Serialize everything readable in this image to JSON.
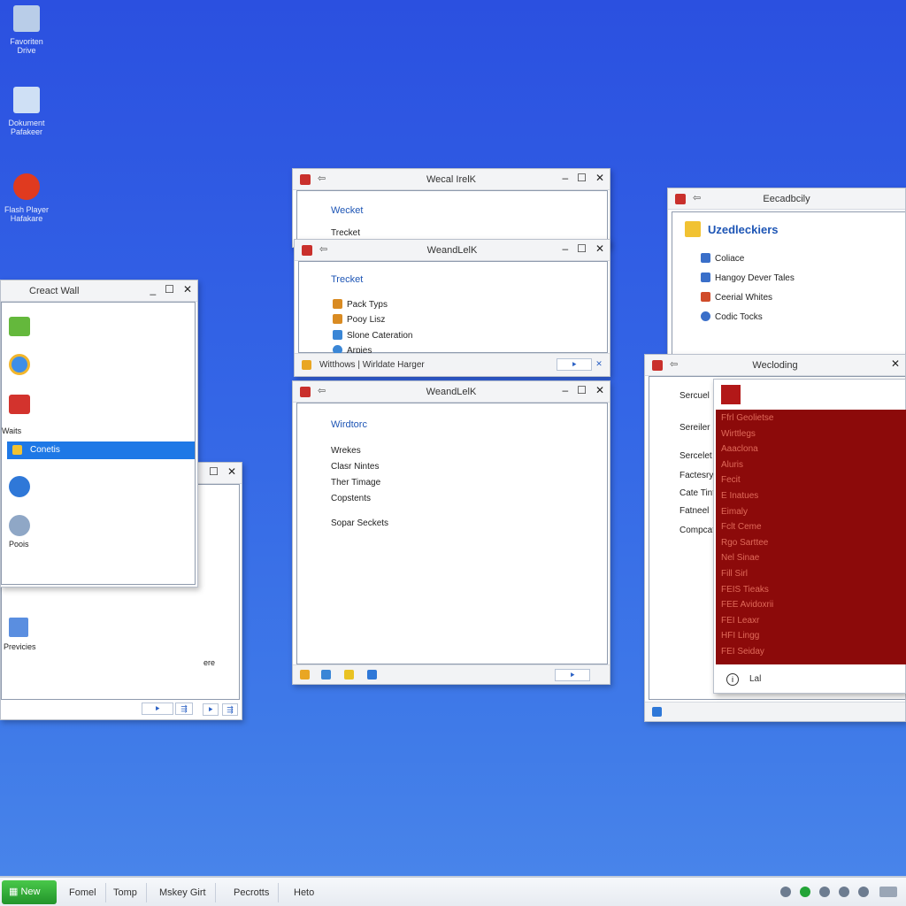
{
  "desktop_icons": [
    {
      "label": "Favoriten Drive",
      "color": "#b9cde8"
    },
    {
      "label": "Dokument Pafakeer",
      "color": "#cfe0f5"
    },
    {
      "label": "Flash Player Hafakare",
      "color": "#e03a1f"
    }
  ],
  "win_left_back": {
    "items": [
      {
        "label": "Previcies",
        "color": "#5a8ee0"
      }
    ],
    "partial_text": "ere",
    "btn1": "⯈",
    "btn2": "⇶"
  },
  "win_left": {
    "title": "Creact Wall",
    "items": [
      {
        "label": "",
        "color": "#64b83c"
      },
      {
        "label": "",
        "color": "#3f8ee6"
      },
      {
        "label": "",
        "color": "#d3332d"
      },
      {
        "label": "Conetis",
        "color": "#f1c232",
        "selected": true
      },
      {
        "label": "",
        "color": "#2f78d8"
      },
      {
        "label": "Poois",
        "color": "#8fa7c6"
      }
    ],
    "side_label": "Waits",
    "btn1": "⯈",
    "btn2": "⇶"
  },
  "win_mid_top": {
    "title": "Wecal Irel⁠K",
    "heading": "Wecket",
    "sub": "Trecket"
  },
  "win_mid_2": {
    "title": "WeandLelK",
    "heading": "Trecket",
    "items": [
      {
        "label": "Pack Typs",
        "color": "#d98b22"
      },
      {
        "label": "Pooy Lisz",
        "color": "#d98b22"
      },
      {
        "label": "Slone Cateration",
        "color": "#3a86d6"
      },
      {
        "label": "Arpies",
        "color": "#3a86d6"
      }
    ],
    "status": "Witthows | Wirldate Harger",
    "btn1": "⯈",
    "btn2": "✕"
  },
  "win_mid_3": {
    "title": "WeandLelK",
    "heading": "Wirdtorc",
    "items": [
      "Wrekes",
      "Clasr Nintes",
      "Ther Timage",
      "Copstents",
      "Sopar Seckets"
    ],
    "btn1": "⯈"
  },
  "win_right_top": {
    "title": "Eecadbcily",
    "heading": "Uzedleckiers",
    "items": [
      {
        "label": "Coliace",
        "color": "#3a6fc9"
      },
      {
        "label": "Hangoy Dever Tales",
        "color": "#3a6fc9"
      },
      {
        "label": "Ceerial Whites",
        "color": "#d04b2a"
      },
      {
        "label": "Codic Tocks",
        "color": "#3a6fc9"
      }
    ]
  },
  "win_right_bottom": {
    "title": "Wecloding",
    "left_links": [
      "Sercuel",
      "Sereiler",
      "Sercelet",
      "Factesry",
      "Cate Tint",
      "Fatneel",
      "Compcat"
    ],
    "panel_items": [
      "Ffrl Geolietse",
      "Wirttlegs",
      "Aaaclona",
      "Aluris",
      "Fecit",
      "E Inatues",
      "Eimaly",
      "Fclt Ceme",
      "Rgo Sarttee",
      "Nel Sinae",
      "Fill Sirl",
      "FEIS Tieaks",
      "FEE Avidoxrii",
      "FEI Leaxr",
      "HFI Lingg",
      "FEI Seiday"
    ],
    "panel_bottom": "Lal",
    "panel_color": "#8c0a0a",
    "panel_head_color": "#b21818"
  },
  "taskbar": {
    "start": "New",
    "items": [
      "Fomel",
      "Tomp",
      "Mskey Girt",
      "Pecrotts",
      "Heto"
    ]
  }
}
